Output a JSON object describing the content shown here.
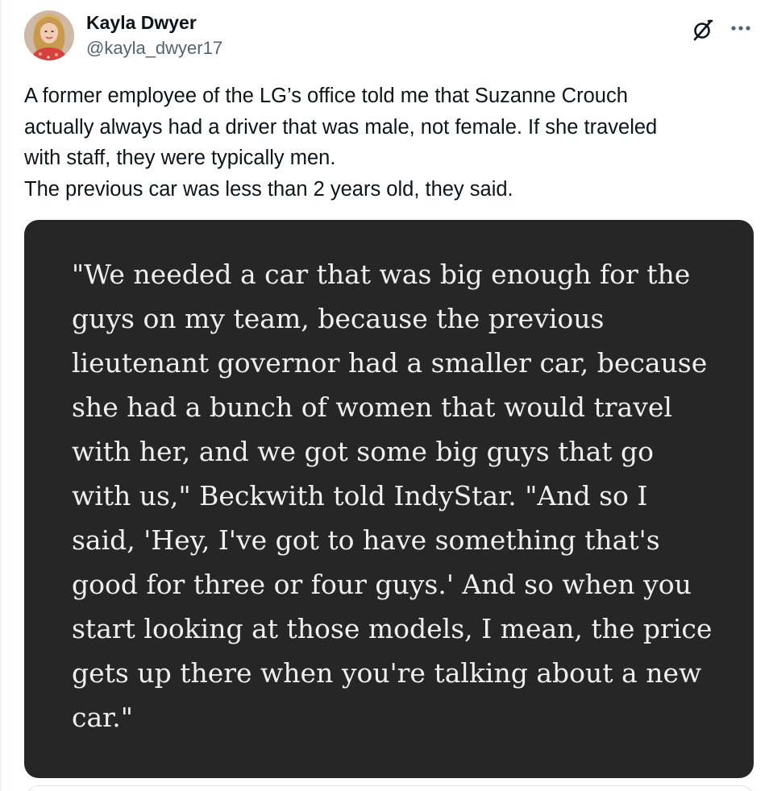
{
  "author": {
    "display_name": "Kayla Dwyer",
    "handle": "@kayla_dwyer17"
  },
  "icons": {
    "avatar": "profile-photo",
    "grok": "grok-icon",
    "more": "more-horizontal-icon"
  },
  "tweet": {
    "lines": [
      "A former employee of the LG’s office told me that Suzanne Crouch",
      "actually always had a driver that was male, not female. If she traveled",
      "with staff, they were typically men.",
      "The previous car was less than 2 years old, they said."
    ]
  },
  "quote_image": {
    "background": "#262626",
    "text_color": "#efefef",
    "lines": [
      "\"We needed a car that was big enough for the",
      "guys on my team, because the previous",
      "lieutenant governor had a smaller car, because",
      "she had a bunch of women that would travel",
      "with her, and we got some big guys that go",
      "with us,\" Beckwith told IndyStar. \"And so I",
      "said, 'Hey, I've got to have something that's",
      "good for three or four guys.' And so when you",
      "start looking at those models, I mean, the price",
      "gets up there when you're talking about a new",
      "car.\""
    ]
  }
}
